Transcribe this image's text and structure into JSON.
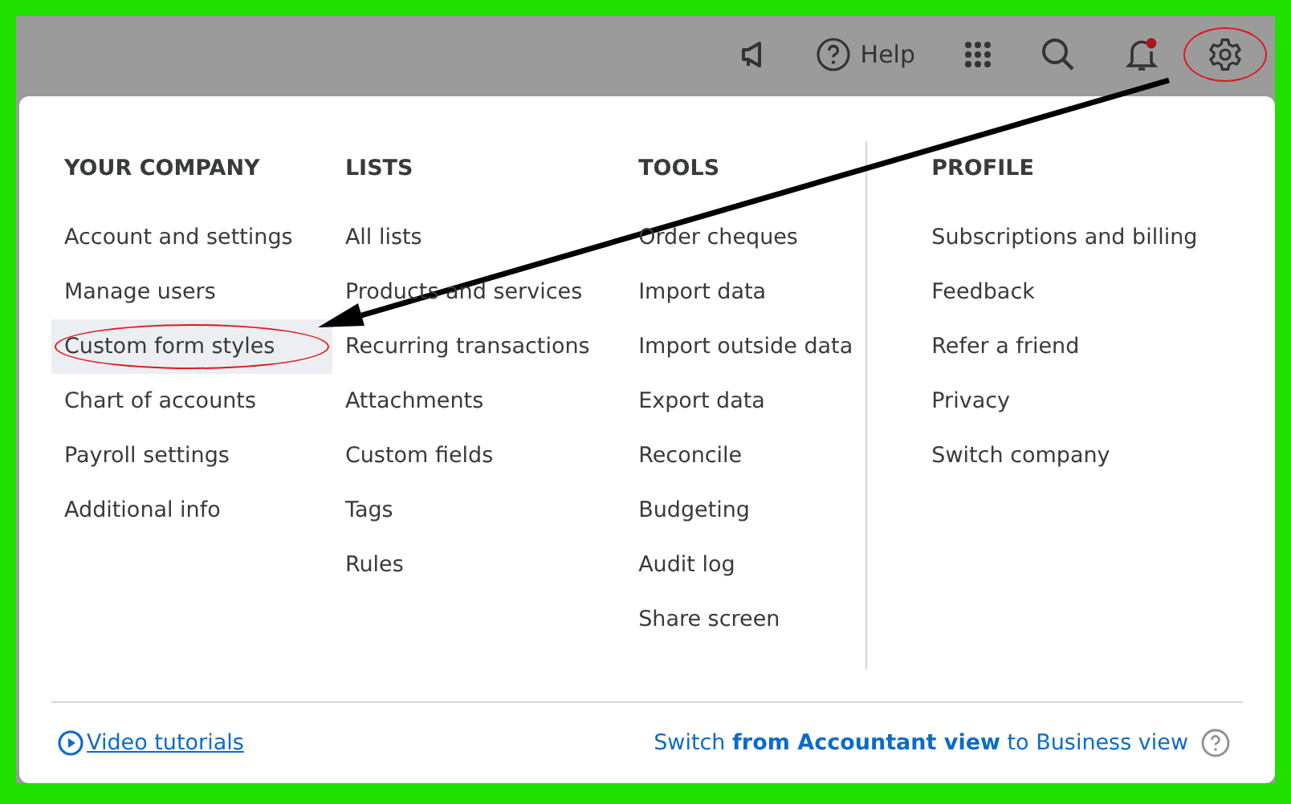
{
  "top_bar": {
    "icons": [
      {
        "kind": "megaphone"
      },
      {
        "kind": "help",
        "label": "Help"
      },
      {
        "kind": "apps"
      },
      {
        "kind": "search"
      },
      {
        "kind": "bell",
        "alert": true
      },
      {
        "kind": "gear",
        "circled": true
      }
    ]
  },
  "menu": {
    "columns": [
      {
        "title": "YOUR COMPANY",
        "items": [
          {
            "label": "Account and settings",
            "selected": false,
            "circled": false
          },
          {
            "label": "Manage users",
            "selected": false,
            "circled": false
          },
          {
            "label": "Custom form styles",
            "selected": true,
            "circled": true
          },
          {
            "label": "Chart of accounts",
            "selected": false,
            "circled": false
          },
          {
            "label": "Payroll settings",
            "selected": false,
            "circled": false
          },
          {
            "label": "Additional info",
            "selected": false,
            "circled": false
          }
        ]
      },
      {
        "title": "LISTS",
        "items": [
          {
            "label": "All lists",
            "selected": false,
            "circled": false
          },
          {
            "label": "Products and services",
            "selected": false,
            "circled": false
          },
          {
            "label": "Recurring transactions",
            "selected": false,
            "circled": false
          },
          {
            "label": "Attachments",
            "selected": false,
            "circled": false
          },
          {
            "label": "Custom fields",
            "selected": false,
            "circled": false
          },
          {
            "label": "Tags",
            "selected": false,
            "circled": false
          },
          {
            "label": "Rules",
            "selected": false,
            "circled": false
          }
        ]
      },
      {
        "title": "TOOLS",
        "items": [
          {
            "label": "Order cheques",
            "selected": false,
            "circled": false
          },
          {
            "label": "Import data",
            "selected": false,
            "circled": false
          },
          {
            "label": "Import outside data",
            "selected": false,
            "circled": false
          },
          {
            "label": "Export data",
            "selected": false,
            "circled": false
          },
          {
            "label": "Reconcile",
            "selected": false,
            "circled": false
          },
          {
            "label": "Budgeting",
            "selected": false,
            "circled": false
          },
          {
            "label": "Audit log",
            "selected": false,
            "circled": false
          },
          {
            "label": "Share screen",
            "selected": false,
            "circled": false
          }
        ]
      },
      {
        "title": "PROFILE",
        "items": [
          {
            "label": "Subscriptions and billing",
            "selected": false,
            "circled": false
          },
          {
            "label": "Feedback",
            "selected": false,
            "circled": false
          },
          {
            "label": "Refer a friend",
            "selected": false,
            "circled": false
          },
          {
            "label": "Privacy",
            "selected": false,
            "circled": false
          },
          {
            "label": "Switch company",
            "selected": false,
            "circled": false
          }
        ]
      }
    ],
    "footer": {
      "video_link": "Video tutorials",
      "switch_link": "Switch **from Accountant view** to Business view"
    }
  }
}
